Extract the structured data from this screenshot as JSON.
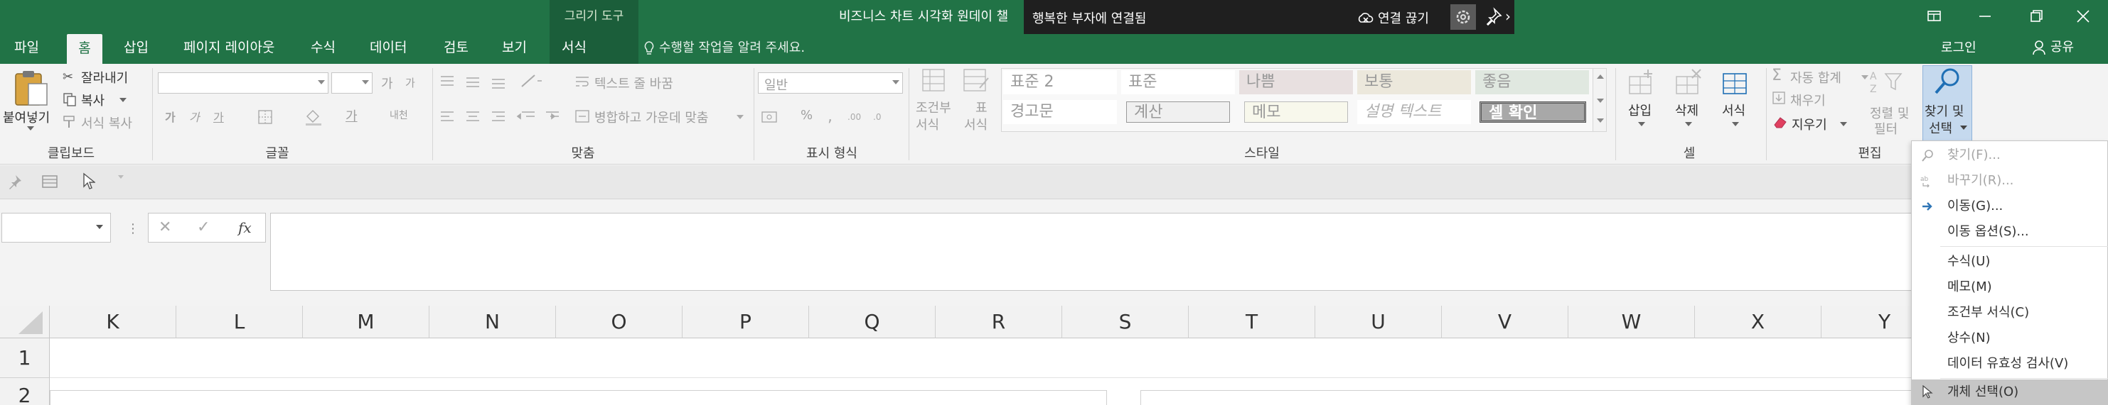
{
  "title_bar": {
    "contextual_group": "그리기 도구",
    "contextual_tab": "서식",
    "document_title": "비즈니스 차트 시각화 원데이 챌",
    "remote_title": "행복한 부자에 연결됨",
    "remote_disconnect": "연결 끊기",
    "signin": "로그인",
    "share": "공유"
  },
  "tabs": [
    "파일",
    "홈",
    "삽입",
    "페이지 레이아웃",
    "수식",
    "데이터",
    "검토",
    "보기"
  ],
  "active_tab": "홈",
  "tell_me": "수행할 작업을 알려 주세요.",
  "ribbon": {
    "clipboard": {
      "label": "클립보드",
      "paste": "붙여넣기",
      "cut": "잘라내기",
      "copy": "복사",
      "format_painter": "서식 복사"
    },
    "font": {
      "label": "글꼴",
      "bold": "가",
      "italic": "가",
      "underline": "가",
      "font_color": "가",
      "grow": "가",
      "shrink": "가",
      "phonetic": "내천"
    },
    "alignment": {
      "label": "맞춤",
      "wrap_text": "텍스트 줄 바꿈",
      "merge_center": "병합하고 가운데 맞춤"
    },
    "number": {
      "label": "표시 형식",
      "format_value": "일반",
      "percent": "%"
    },
    "styles": {
      "label": "스타일",
      "conditional_formatting": [
        "조건부",
        "서식"
      ],
      "format_as_table": [
        "표",
        "서식"
      ],
      "cells": [
        "표준 2",
        "표준",
        "나쁨",
        "보통",
        "좋음",
        "경고문",
        "계산",
        "메모",
        "설명 텍스트",
        "셀 확인"
      ]
    },
    "cells": {
      "label": "셀",
      "insert": "삽입",
      "delete": "삭제",
      "format": "서식"
    },
    "editing": {
      "label": "편집",
      "autosum": "자동 합계",
      "fill": "채우기",
      "clear": "지우기",
      "sort_filter": [
        "정렬 및",
        "필터"
      ],
      "find_select": [
        "찾기 및",
        "선택"
      ]
    }
  },
  "formula_bar": {
    "cancel": "✕",
    "enter": "✓",
    "fx": "fx",
    "value": ""
  },
  "columns": [
    "K",
    "L",
    "M",
    "N",
    "O",
    "P",
    "Q",
    "R",
    "S",
    "T",
    "U",
    "V",
    "W",
    "X",
    "Y"
  ],
  "rows": [
    "1",
    "2"
  ],
  "dropdown_menu": {
    "items": [
      {
        "label": "찾기(F)...",
        "disabled": true,
        "icon": "search-icon"
      },
      {
        "label": "바꾸기(R)...",
        "disabled": true,
        "icon": "replace-icon"
      },
      {
        "label": "이동(G)...",
        "disabled": false,
        "icon": "arrow-right-icon"
      },
      {
        "label": "이동 옵션(S)...",
        "disabled": false,
        "icon": ""
      },
      {
        "label": "수식(U)",
        "disabled": false,
        "icon": ""
      },
      {
        "label": "메모(M)",
        "disabled": false,
        "icon": ""
      },
      {
        "label": "조건부 서식(C)",
        "disabled": false,
        "icon": ""
      },
      {
        "label": "상수(N)",
        "disabled": false,
        "icon": ""
      },
      {
        "label": "데이터 유효성 검사(V)",
        "disabled": false,
        "icon": ""
      },
      {
        "label": "개체 선택(O)",
        "disabled": false,
        "icon": "pointer-icon"
      }
    ]
  },
  "colors": {
    "excel_green": "#217346",
    "ribbon_bg": "#f3f3f3",
    "accent_blue": "#2e75b6"
  }
}
